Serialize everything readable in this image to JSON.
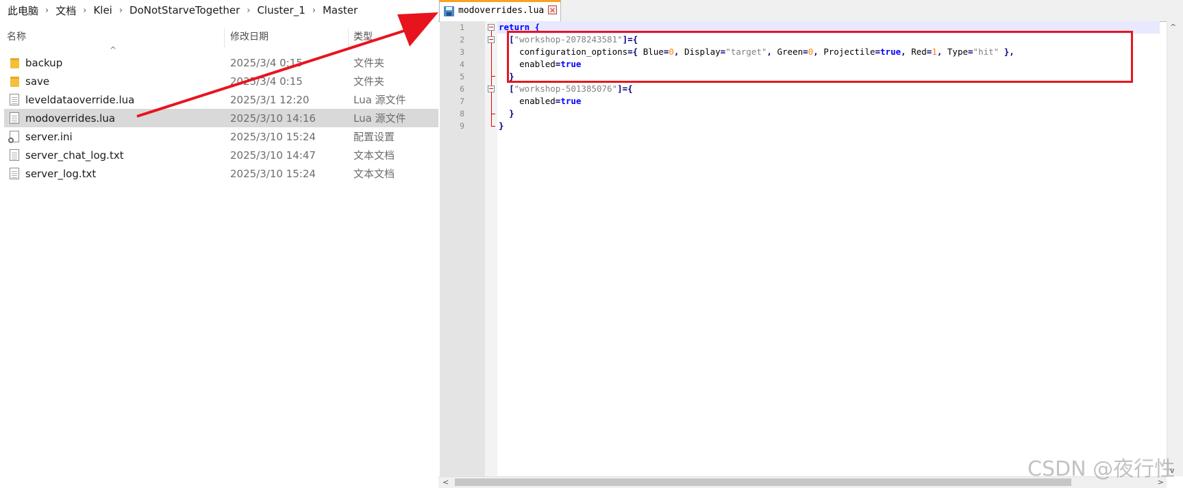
{
  "explorer": {
    "breadcrumb": [
      "此电脑",
      "文档",
      "Klei",
      "DoNotStarveTogether",
      "Cluster_1",
      "Master"
    ],
    "columns": {
      "name": "名称",
      "date": "修改日期",
      "type": "类型"
    },
    "files": [
      {
        "name": "backup",
        "date": "2025/3/4 0:15",
        "type": "文件夹",
        "icon": "folder-icon"
      },
      {
        "name": "save",
        "date": "2025/3/4 0:15",
        "type": "文件夹",
        "icon": "folder-icon"
      },
      {
        "name": "leveldataoverride.lua",
        "date": "2025/3/1 12:20",
        "type": "Lua 源文件",
        "icon": "lua-file-icon"
      },
      {
        "name": "modoverrides.lua",
        "date": "2025/3/10 14:16",
        "type": "Lua 源文件",
        "icon": "lua-file-icon",
        "selected": true
      },
      {
        "name": "server.ini",
        "date": "2025/3/10 15:24",
        "type": "配置设置",
        "icon": "config-file-icon"
      },
      {
        "name": "server_chat_log.txt",
        "date": "2025/3/10 14:47",
        "type": "文本文档",
        "icon": "text-file-icon"
      },
      {
        "name": "server_log.txt",
        "date": "2025/3/10 15:24",
        "type": "文本文档",
        "icon": "text-file-icon"
      }
    ]
  },
  "editor": {
    "tab": {
      "title": "modoverrides.lua",
      "close": "✕"
    },
    "line_numbers": [
      "1",
      "2",
      "3",
      "4",
      "5",
      "6",
      "7",
      "8",
      "9"
    ],
    "code": {
      "l1": "return {",
      "l2_key": "\"workshop-2078243581\"",
      "l3_prefix": "configuration_options",
      "l3_blue_key": "Blue",
      "l3_blue_val": "0",
      "l3_display_key": "Display",
      "l3_display_val": "\"target\"",
      "l3_green_key": "Green",
      "l3_green_val": "0",
      "l3_proj_key": "Projectile",
      "l3_proj_val": "true",
      "l3_red_key": "Red",
      "l3_red_val": "1",
      "l3_type_key": "Type",
      "l3_type_val": "\"hit\"",
      "l4_key": "enabled",
      "l4_val": "true",
      "l6_key": "\"workshop-501385076\"",
      "l7_key": "enabled",
      "l7_val": "true"
    }
  },
  "watermark": "CSDN @夜行性",
  "colors": {
    "annotation_red": "#e8141d",
    "tab_accent": "#f7a224",
    "keyword_blue": "#0000ff"
  }
}
